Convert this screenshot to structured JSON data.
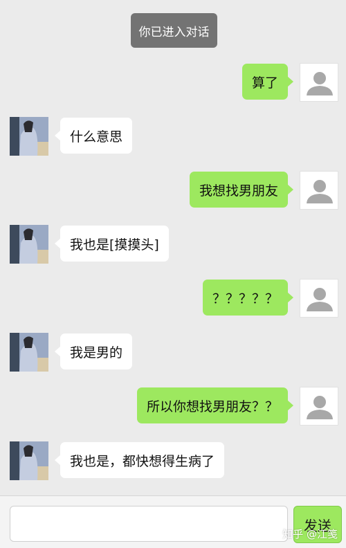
{
  "system_notice": "你已进入对话",
  "messages": [
    {
      "sender": "me",
      "text": "算了"
    },
    {
      "sender": "them",
      "text": "什么意思"
    },
    {
      "sender": "me",
      "text": "我想找男朋友"
    },
    {
      "sender": "them",
      "text": "我也是[摸摸头]"
    },
    {
      "sender": "me",
      "text": "？？？？？"
    },
    {
      "sender": "them",
      "text": "我是男的"
    },
    {
      "sender": "me",
      "text": "所以你想找男朋友？？"
    },
    {
      "sender": "them",
      "text": "我也是，都快想得生病了"
    }
  ],
  "input": {
    "value": "",
    "placeholder": ""
  },
  "send_label": "发送",
  "watermark": "知乎 @江笺",
  "colors": {
    "background": "#ebebeb",
    "my_bubble": "#9de85f",
    "their_bubble": "#ffffff",
    "notice": "#737373",
    "send_button": "#9de85f"
  }
}
